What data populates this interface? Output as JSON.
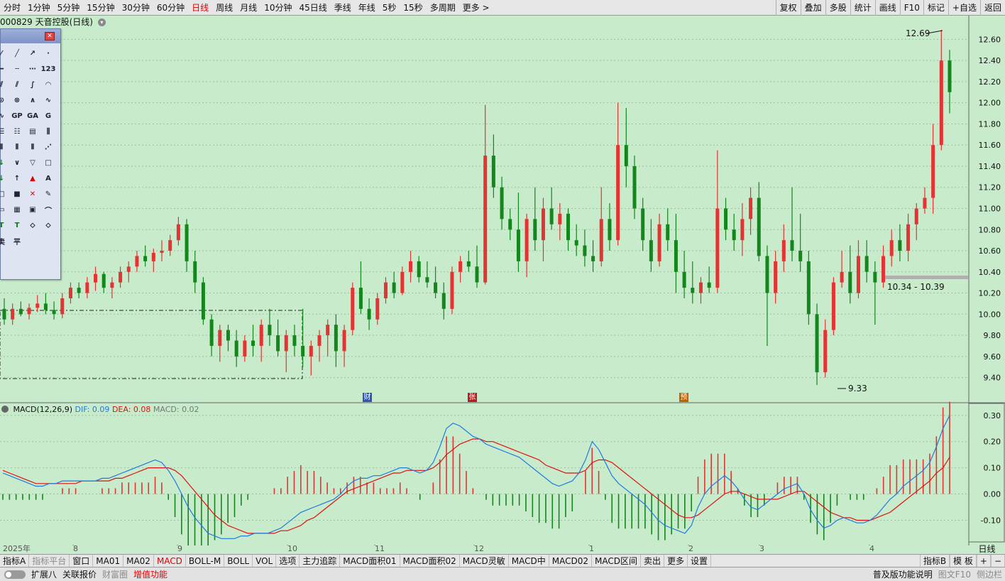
{
  "periods": [
    "分时",
    "1分钟",
    "5分钟",
    "15分钟",
    "30分钟",
    "60分钟",
    "日线",
    "周线",
    "月线",
    "10分钟",
    "45日线",
    "季线",
    "年线",
    "5秒",
    "15秒",
    "多周期",
    "更多 >"
  ],
  "active_period": "日线",
  "right_tools": [
    "复权",
    "叠加",
    "多股",
    "统计",
    "画线",
    "F10",
    "标记",
    "+自选",
    "返回"
  ],
  "chart_title": "000829 天音控股(日线)",
  "price_axis": [
    "12.60",
    "12.40",
    "12.20",
    "12.00",
    "11.80",
    "11.60",
    "11.40",
    "11.20",
    "11.00",
    "10.80",
    "10.60",
    "10.40",
    "10.20",
    "10.00",
    "9.80",
    "9.60",
    "9.40"
  ],
  "macd_axis": [
    "0.30",
    "0.20",
    "0.10",
    "0.00",
    "-0.10"
  ],
  "annotations": {
    "high": "12.69",
    "low": "9.33",
    "range": "10.34 - 10.39"
  },
  "signals": [
    {
      "text": "财",
      "color": "#2f55b8"
    },
    {
      "text": "张",
      "color": "#b02020"
    },
    {
      "text": "预",
      "color": "#c06000"
    }
  ],
  "macd_header": {
    "title": "MACD(12,26,9)",
    "dif": "DIF: 0.09",
    "dea": "DEA: 0.08",
    "macd": "MACD: 0.02",
    "dif_color": "#1e7be0",
    "dea_color": "#e01010"
  },
  "x_labels": [
    "2025年",
    "8",
    "9",
    "10",
    "11",
    "12",
    "1",
    "2",
    "3",
    "4"
  ],
  "x_axis_right": "日线",
  "draw_tools": [
    "A",
    "T",
    "卖",
    "平",
    "GP",
    "GA",
    "G",
    "123"
  ],
  "tabs": [
    {
      "label": "指标A",
      "style": ""
    },
    {
      "label": "指标平台",
      "style": "dim"
    },
    {
      "label": "窗口",
      "style": ""
    },
    {
      "label": "MA01",
      "style": ""
    },
    {
      "label": "MA02",
      "style": ""
    },
    {
      "label": "MACD",
      "style": "act"
    },
    {
      "label": "BOLL-M",
      "style": ""
    },
    {
      "label": "BOLL",
      "style": ""
    },
    {
      "label": "VOL",
      "style": ""
    },
    {
      "label": "选项",
      "style": ""
    },
    {
      "label": "主力追踪",
      "style": ""
    },
    {
      "label": "MACD面积01",
      "style": ""
    },
    {
      "label": "MACD面积02",
      "style": ""
    },
    {
      "label": "MACD灵敏",
      "style": ""
    },
    {
      "label": "MACD中",
      "style": ""
    },
    {
      "label": "MACD02",
      "style": ""
    },
    {
      "label": "MACD区间",
      "style": ""
    },
    {
      "label": "卖出",
      "style": ""
    },
    {
      "label": "更多",
      "style": ""
    },
    {
      "label": "设置",
      "style": ""
    }
  ],
  "tabs_right": [
    "指标B",
    "模 板",
    "+",
    "−"
  ],
  "status_left": [
    {
      "label": "扩展八",
      "style": ""
    },
    {
      "label": "关联报价",
      "style": ""
    },
    {
      "label": "财富圈",
      "style": "dim"
    },
    {
      "label": "增值功能",
      "style": "red"
    }
  ],
  "status_right": [
    {
      "label": "普及版功能说明",
      "style": ""
    },
    {
      "label": "图文F10",
      "style": "dim"
    },
    {
      "label": "侧边栏",
      "style": "dim"
    }
  ],
  "chart_data": {
    "type": "candlestick",
    "title": "000829 天音控股(日线)",
    "ylim": [
      9.3,
      12.7
    ],
    "candles": [
      [
        10.05,
        10.15,
        9.9,
        9.95
      ],
      [
        9.95,
        10.1,
        9.9,
        10.05
      ],
      [
        10.05,
        10.12,
        9.98,
        10.0
      ],
      [
        10.0,
        10.1,
        9.95,
        10.06
      ],
      [
        10.06,
        10.18,
        10.02,
        10.1
      ],
      [
        10.1,
        10.2,
        10.0,
        10.04
      ],
      [
        10.04,
        10.12,
        9.95,
        10.0
      ],
      [
        10.0,
        10.2,
        9.96,
        10.15
      ],
      [
        10.15,
        10.3,
        10.1,
        10.25
      ],
      [
        10.25,
        10.3,
        10.15,
        10.2
      ],
      [
        10.2,
        10.35,
        10.15,
        10.3
      ],
      [
        10.3,
        10.45,
        10.22,
        10.38
      ],
      [
        10.38,
        10.4,
        10.2,
        10.25
      ],
      [
        10.25,
        10.35,
        10.15,
        10.3
      ],
      [
        10.3,
        10.45,
        10.25,
        10.4
      ],
      [
        10.4,
        10.5,
        10.3,
        10.45
      ],
      [
        10.45,
        10.6,
        10.4,
        10.55
      ],
      [
        10.55,
        10.65,
        10.45,
        10.5
      ],
      [
        10.5,
        10.62,
        10.4,
        10.58
      ],
      [
        10.58,
        10.7,
        10.5,
        10.6
      ],
      [
        10.6,
        10.75,
        10.55,
        10.7
      ],
      [
        10.7,
        10.92,
        10.65,
        10.85
      ],
      [
        10.85,
        10.9,
        10.4,
        10.5
      ],
      [
        10.5,
        10.6,
        10.2,
        10.3
      ],
      [
        10.3,
        10.35,
        9.9,
        9.95
      ],
      [
        9.95,
        10.0,
        9.6,
        9.7
      ],
      [
        9.7,
        9.9,
        9.55,
        9.85
      ],
      [
        9.85,
        9.9,
        9.65,
        9.75
      ],
      [
        9.75,
        9.85,
        9.5,
        9.6
      ],
      [
        9.6,
        9.8,
        9.55,
        9.75
      ],
      [
        9.75,
        9.9,
        9.6,
        9.7
      ],
      [
        9.7,
        9.95,
        9.55,
        9.9
      ],
      [
        9.9,
        10.05,
        9.7,
        9.8
      ],
      [
        9.8,
        9.95,
        9.6,
        9.65
      ],
      [
        9.65,
        9.85,
        9.45,
        9.8
      ],
      [
        9.8,
        9.9,
        9.6,
        9.7
      ],
      [
        9.7,
        10.05,
        9.5,
        9.6
      ],
      [
        9.6,
        9.75,
        9.42,
        9.7
      ],
      [
        9.7,
        9.85,
        9.55,
        9.8
      ],
      [
        9.8,
        9.95,
        9.6,
        9.9
      ],
      [
        9.9,
        10.0,
        9.5,
        9.65
      ],
      [
        9.65,
        9.9,
        9.5,
        9.85
      ],
      [
        9.85,
        10.3,
        9.8,
        10.25
      ],
      [
        10.25,
        10.5,
        10.0,
        10.05
      ],
      [
        10.05,
        10.15,
        9.85,
        9.95
      ],
      [
        9.95,
        10.2,
        9.9,
        10.15
      ],
      [
        10.15,
        10.35,
        10.1,
        10.3
      ],
      [
        10.3,
        10.4,
        10.15,
        10.2
      ],
      [
        10.2,
        10.45,
        10.18,
        10.4
      ],
      [
        10.4,
        10.6,
        10.3,
        10.5
      ],
      [
        10.5,
        10.55,
        10.3,
        10.35
      ],
      [
        10.35,
        10.5,
        10.25,
        10.3
      ],
      [
        10.3,
        10.45,
        10.15,
        10.2
      ],
      [
        10.2,
        10.3,
        9.95,
        10.05
      ],
      [
        10.05,
        10.45,
        10.0,
        10.4
      ],
      [
        10.4,
        10.55,
        10.3,
        10.5
      ],
      [
        10.5,
        10.6,
        10.4,
        10.45
      ],
      [
        10.45,
        10.65,
        10.25,
        10.3
      ],
      [
        10.3,
        11.98,
        10.28,
        11.5
      ],
      [
        11.5,
        11.7,
        11.1,
        11.2
      ],
      [
        11.2,
        11.3,
        10.8,
        10.9
      ],
      [
        10.9,
        11.0,
        10.7,
        10.8
      ],
      [
        10.8,
        11.15,
        10.4,
        10.5
      ],
      [
        10.5,
        10.95,
        10.35,
        10.9
      ],
      [
        10.9,
        11.2,
        10.6,
        10.7
      ],
      [
        10.7,
        11.1,
        10.5,
        11.0
      ],
      [
        11.0,
        11.2,
        10.8,
        10.85
      ],
      [
        10.85,
        11.05,
        10.7,
        10.95
      ],
      [
        10.95,
        11.0,
        10.6,
        10.7
      ],
      [
        10.7,
        10.85,
        10.55,
        10.65
      ],
      [
        10.65,
        10.8,
        10.45,
        10.55
      ],
      [
        10.55,
        10.7,
        10.4,
        10.5
      ],
      [
        10.5,
        11.2,
        10.45,
        10.9
      ],
      [
        10.9,
        11.05,
        10.6,
        10.7
      ],
      [
        10.7,
        12.0,
        10.65,
        11.6
      ],
      [
        11.6,
        11.95,
        11.2,
        11.4
      ],
      [
        11.4,
        11.5,
        10.9,
        11.0
      ],
      [
        11.0,
        11.1,
        10.6,
        10.7
      ],
      [
        10.7,
        10.9,
        10.4,
        10.5
      ],
      [
        10.5,
        10.95,
        10.45,
        10.85
      ],
      [
        10.85,
        11.0,
        10.6,
        10.7
      ],
      [
        10.7,
        10.95,
        10.2,
        10.4
      ],
      [
        10.4,
        10.6,
        10.15,
        10.25
      ],
      [
        10.25,
        10.5,
        10.1,
        10.2
      ],
      [
        10.2,
        10.35,
        10.1,
        10.3
      ],
      [
        10.3,
        10.45,
        10.2,
        10.25
      ],
      [
        10.25,
        11.55,
        10.2,
        11.0
      ],
      [
        11.0,
        11.1,
        10.7,
        10.8
      ],
      [
        10.8,
        10.95,
        10.6,
        10.7
      ],
      [
        10.7,
        11.05,
        10.55,
        10.9
      ],
      [
        10.9,
        11.2,
        10.75,
        11.1
      ],
      [
        11.1,
        11.25,
        10.5,
        10.55
      ],
      [
        10.55,
        10.65,
        9.7,
        10.2
      ],
      [
        10.2,
        10.6,
        10.1,
        10.5
      ],
      [
        10.5,
        10.85,
        10.4,
        10.7
      ],
      [
        10.7,
        11.2,
        10.5,
        10.6
      ],
      [
        10.6,
        10.95,
        10.4,
        10.5
      ],
      [
        10.5,
        10.6,
        9.9,
        10.0
      ],
      [
        10.0,
        10.1,
        9.33,
        9.45
      ],
      [
        9.45,
        9.95,
        9.4,
        9.85
      ],
      [
        9.85,
        10.35,
        9.8,
        10.3
      ],
      [
        10.3,
        10.6,
        10.25,
        10.4
      ],
      [
        10.4,
        10.65,
        10.1,
        10.2
      ],
      [
        10.2,
        10.7,
        10.15,
        10.55
      ],
      [
        10.55,
        10.7,
        10.3,
        10.4
      ],
      [
        10.4,
        10.5,
        9.9,
        10.3
      ],
      [
        10.3,
        10.65,
        10.25,
        10.55
      ],
      [
        10.55,
        10.8,
        10.45,
        10.7
      ],
      [
        10.7,
        10.85,
        10.5,
        10.6
      ],
      [
        10.6,
        10.95,
        10.5,
        10.85
      ],
      [
        10.85,
        11.05,
        10.7,
        11.0
      ],
      [
        11.0,
        11.2,
        10.95,
        11.1
      ],
      [
        11.1,
        11.8,
        10.95,
        11.6
      ],
      [
        11.6,
        12.69,
        11.55,
        12.4
      ],
      [
        12.4,
        12.5,
        11.9,
        12.1
      ]
    ],
    "macd": {
      "dif": [
        0.08,
        0.07,
        0.06,
        0.05,
        0.04,
        0.03,
        0.03,
        0.04,
        0.04,
        0.05,
        0.05,
        0.05,
        0.05,
        0.05,
        0.05,
        0.06,
        0.06,
        0.07,
        0.08,
        0.09,
        0.1,
        0.11,
        0.12,
        0.13,
        0.12,
        0.09,
        0.05,
        0.0,
        -0.05,
        -0.09,
        -0.12,
        -0.15,
        -0.16,
        -0.17,
        -0.17,
        -0.17,
        -0.16,
        -0.16,
        -0.15,
        -0.15,
        -0.15,
        -0.14,
        -0.13,
        -0.11,
        -0.09,
        -0.07,
        -0.06,
        -0.05,
        -0.04,
        -0.03,
        -0.02,
        0.0,
        0.03,
        0.05,
        0.06,
        0.06,
        0.07,
        0.07,
        0.08,
        0.09,
        0.1,
        0.1,
        0.09,
        0.08,
        0.09,
        0.12,
        0.18,
        0.25,
        0.27,
        0.26,
        0.24,
        0.22,
        0.21,
        0.19,
        0.18,
        0.17,
        0.16,
        0.15,
        0.14,
        0.12,
        0.1,
        0.08,
        0.06,
        0.04,
        0.03,
        0.04,
        0.05,
        0.08,
        0.13,
        0.2,
        0.17,
        0.12,
        0.07,
        0.04,
        0.02,
        0.0,
        -0.02,
        -0.04,
        -0.07,
        -0.1,
        -0.12,
        -0.13,
        -0.14,
        -0.15,
        -0.12,
        -0.05,
        0.0,
        0.03,
        0.05,
        0.07,
        0.05,
        0.02,
        -0.02,
        -0.05,
        -0.06,
        -0.04,
        -0.02,
        0.0,
        0.02,
        0.03,
        0.04,
        0.0,
        -0.06,
        -0.1,
        -0.13,
        -0.12,
        -0.1,
        -0.09,
        -0.1,
        -0.11,
        -0.11,
        -0.1,
        -0.08,
        -0.05,
        -0.02,
        0.0,
        0.03,
        0.05,
        0.07,
        0.09,
        0.12,
        0.18,
        0.25,
        0.3
      ],
      "dea": [
        0.09,
        0.08,
        0.07,
        0.06,
        0.05,
        0.04,
        0.04,
        0.04,
        0.04,
        0.04,
        0.04,
        0.04,
        0.05,
        0.05,
        0.05,
        0.05,
        0.05,
        0.06,
        0.06,
        0.07,
        0.08,
        0.09,
        0.1,
        0.1,
        0.1,
        0.1,
        0.09,
        0.07,
        0.04,
        0.01,
        -0.02,
        -0.05,
        -0.08,
        -0.1,
        -0.12,
        -0.13,
        -0.14,
        -0.15,
        -0.15,
        -0.15,
        -0.15,
        -0.15,
        -0.14,
        -0.14,
        -0.13,
        -0.12,
        -0.1,
        -0.09,
        -0.07,
        -0.05,
        -0.03,
        -0.01,
        0.01,
        0.02,
        0.03,
        0.04,
        0.05,
        0.06,
        0.07,
        0.08,
        0.08,
        0.09,
        0.09,
        0.09,
        0.09,
        0.1,
        0.12,
        0.15,
        0.17,
        0.19,
        0.2,
        0.21,
        0.21,
        0.2,
        0.2,
        0.19,
        0.18,
        0.17,
        0.16,
        0.15,
        0.14,
        0.13,
        0.11,
        0.1,
        0.09,
        0.08,
        0.08,
        0.08,
        0.09,
        0.12,
        0.13,
        0.13,
        0.12,
        0.1,
        0.08,
        0.06,
        0.04,
        0.02,
        0.0,
        -0.02,
        -0.04,
        -0.06,
        -0.08,
        -0.09,
        -0.09,
        -0.08,
        -0.06,
        -0.04,
        -0.02,
        0.0,
        0.01,
        0.01,
        0.0,
        -0.01,
        -0.02,
        -0.02,
        -0.02,
        -0.02,
        -0.01,
        0.0,
        0.01,
        0.01,
        -0.01,
        -0.03,
        -0.05,
        -0.07,
        -0.08,
        -0.09,
        -0.09,
        -0.1,
        -0.1,
        -0.1,
        -0.09,
        -0.08,
        -0.07,
        -0.05,
        -0.03,
        -0.01,
        0.01,
        0.03,
        0.05,
        0.08,
        0.1,
        0.14
      ]
    }
  }
}
